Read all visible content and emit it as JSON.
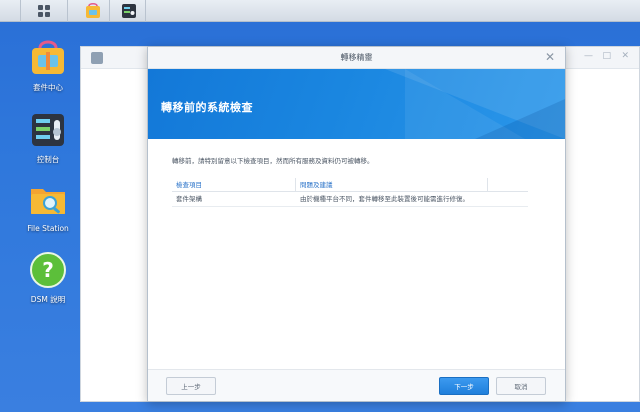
{
  "taskbar": {
    "items": [
      {
        "name": "main-menu",
        "icon": "grid-icon"
      },
      {
        "name": "package-center",
        "icon": "package-center-icon"
      },
      {
        "name": "control-panel",
        "icon": "control-panel-icon"
      }
    ]
  },
  "desktop": {
    "icons": [
      {
        "label": "套件中心",
        "icon": "package-center-icon"
      },
      {
        "label": "控制台",
        "icon": "control-panel-icon"
      },
      {
        "label": "File Station",
        "icon": "file-station-icon"
      },
      {
        "label": "DSM 說明",
        "icon": "help-icon"
      }
    ]
  },
  "dialog": {
    "title": "轉移精靈",
    "close_glyph": "✕",
    "banner_title": "轉移前的系統檢查",
    "intro": "轉移前，請特別留意以下檢查項目，然而所有服務及資料仍可被轉移。",
    "table": {
      "headers": [
        "檢查項目",
        "問題及建議"
      ],
      "rows": [
        [
          "套件架構",
          "由於機種平台不同，套件轉移至此裝置後可能需進行修復。"
        ]
      ]
    },
    "buttons": {
      "prev": "上一步",
      "next": "下一步",
      "cancel": "取消"
    }
  },
  "colors": {
    "desktop": "#2f78dc",
    "banner": "#1a86e0",
    "link": "#2a73c9",
    "primary_button": "#1f7fdb"
  }
}
